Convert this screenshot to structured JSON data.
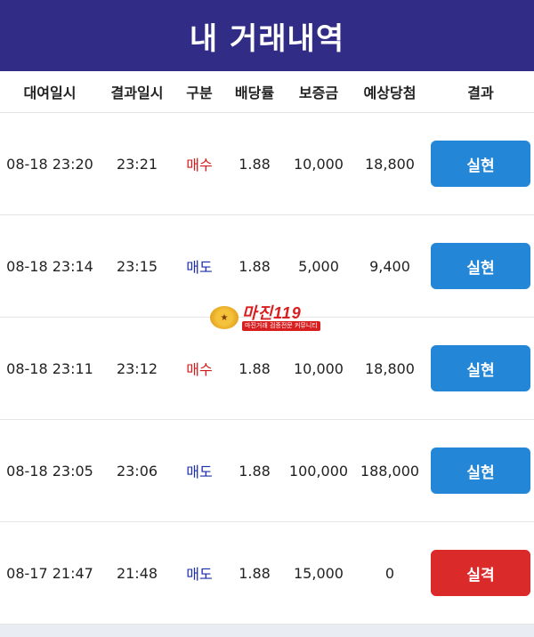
{
  "title": "내 거래내역",
  "columns": {
    "start": "대여일시",
    "end": "결과일시",
    "type": "구분",
    "rate": "배당률",
    "deposit": "보증금",
    "expected": "예상당첨",
    "result": "결과"
  },
  "rows": [
    {
      "start": "08-18 23:20",
      "end": "23:21",
      "type": "매수",
      "rate": "1.88",
      "deposit": "10,000",
      "expected": "18,800",
      "result": "실현"
    },
    {
      "start": "08-18 23:14",
      "end": "23:15",
      "type": "매도",
      "rate": "1.88",
      "deposit": "5,000",
      "expected": "9,400",
      "result": "실현"
    },
    {
      "start": "08-18 23:11",
      "end": "23:12",
      "type": "매수",
      "rate": "1.88",
      "deposit": "10,000",
      "expected": "18,800",
      "result": "실현"
    },
    {
      "start": "08-18 23:05",
      "end": "23:06",
      "type": "매도",
      "rate": "1.88",
      "deposit": "100,000",
      "expected": "188,000",
      "result": "실현"
    },
    {
      "start": "08-17 21:47",
      "end": "21:48",
      "type": "매도",
      "rate": "1.88",
      "deposit": "15,000",
      "expected": "0",
      "result": "실격"
    }
  ],
  "watermark": {
    "logo": "마진119",
    "subtitle": "마진거래 검증전문 커뮤니티"
  },
  "colors": {
    "header_bg": "#312d86",
    "buy": "#d21b1b",
    "sell": "#1a2ea8",
    "win_button": "#2386d6",
    "lose_button": "#da2a2a"
  }
}
